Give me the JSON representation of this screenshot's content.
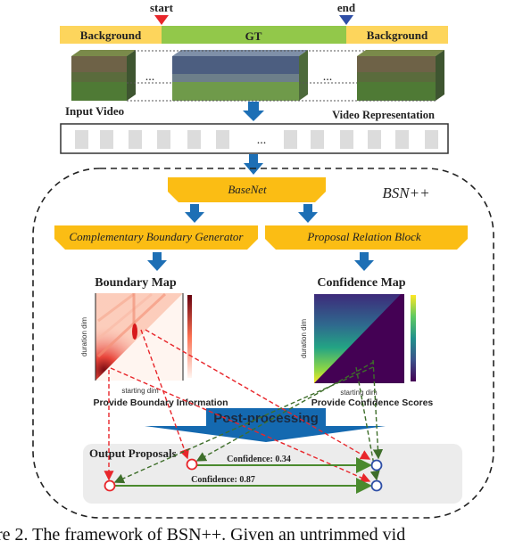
{
  "timeline": {
    "segments": [
      {
        "label": "Background",
        "color": "#fdd55c"
      },
      {
        "label": "GT",
        "color": "#92c84a"
      },
      {
        "label": "Background",
        "color": "#fdd55c"
      }
    ],
    "start_label": "start",
    "end_label": "end",
    "start_color": "#e8262b",
    "end_color": "#2e4ea6"
  },
  "input_video": {
    "label": "Input Video",
    "ellipsis": "..."
  },
  "representation": {
    "label": "Video Representation",
    "ellipsis": "...",
    "block_count": 12
  },
  "bsn": {
    "title": "BSN++",
    "basenet": "BaseNet",
    "cbg": "Complementary Boundary Generator",
    "prb": "Proposal Relation Block",
    "module_color": "#fbbd14",
    "arrow_color": "#1d6fb5"
  },
  "boundary_map": {
    "title": "Boundary Map",
    "xlabel": "starting dim",
    "ylabel": "duration dim",
    "provide": "Provide Boundary Information"
  },
  "confidence_map": {
    "title": "Confidence Map",
    "xlabel": "starting dim",
    "ylabel": "duration dim",
    "provide": "Provide Confidence Scores"
  },
  "post_processing": {
    "label": "Post-processing",
    "color": "#1469b0"
  },
  "output": {
    "label": "Output Proposals",
    "proposals": [
      {
        "confidence_label": "Confidence: 0.34"
      },
      {
        "confidence_label": "Confidence: 0.87"
      }
    ]
  },
  "caption": "ure 2. The framework of BSN++. Given an untrimmed vid"
}
